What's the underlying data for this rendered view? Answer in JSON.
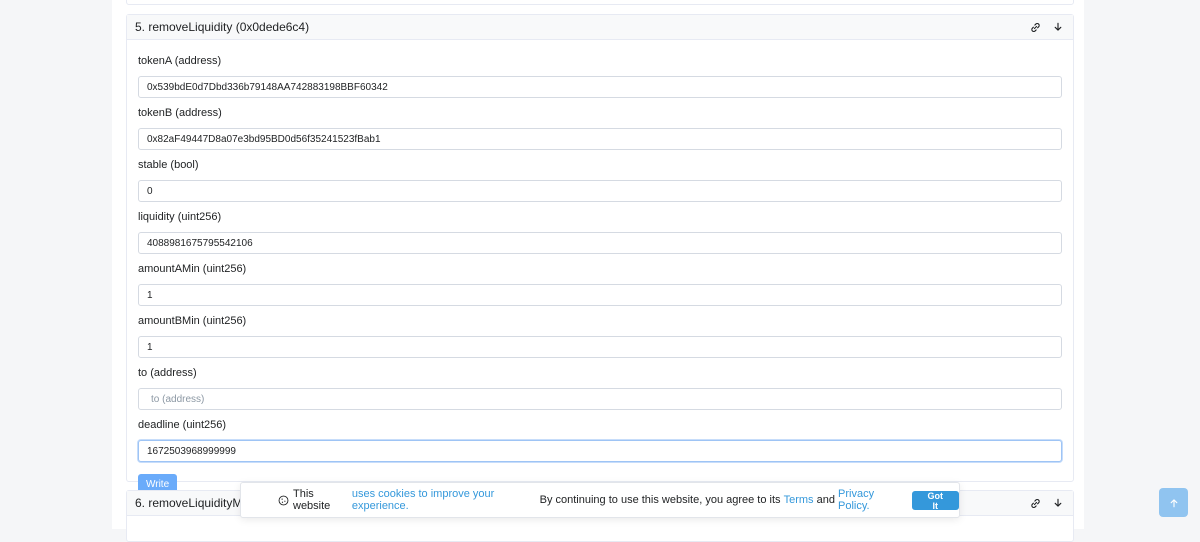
{
  "colors": {
    "accent": "#3498db",
    "write_button": "#6aabfa",
    "scroll_top_button": "#90c4f0",
    "border": "#e7eaf3"
  },
  "function_5": {
    "title": "5. removeLiquidity (0x0dede6c4)",
    "icons": [
      "link-icon",
      "arrow-down-icon"
    ],
    "fields": [
      {
        "label": "tokenA (address)",
        "value": "0x539bdE0d7Dbd336b79148AA742883198BBF60342",
        "placeholder": "tokenA (address)"
      },
      {
        "label": "tokenB (address)",
        "value": "0x82aF49447D8a07e3bd95BD0d56f35241523fBab1",
        "placeholder": "tokenB (address)"
      },
      {
        "label": "stable (bool)",
        "value": "0",
        "placeholder": "stable (bool)"
      },
      {
        "label": "liquidity (uint256)",
        "value": "4088981675795542106",
        "placeholder": "liquidity (uint256)"
      },
      {
        "label": "amountAMin (uint256)",
        "value": "1",
        "placeholder": "amountAMin (uint256)"
      },
      {
        "label": "amountBMin (uint256)",
        "value": "1",
        "placeholder": "amountBMin (uint256)"
      },
      {
        "label": "to (address)",
        "value": "",
        "placeholder": "to (address)"
      },
      {
        "label": "deadline (uint256)",
        "value": "1672503968999999",
        "placeholder": "deadline (uint256)"
      }
    ],
    "write_label": "Write"
  },
  "function_6": {
    "title": "6. removeLiquidityMATIC (",
    "icons": [
      "link-icon",
      "arrow-down-icon"
    ]
  },
  "cookie_banner": {
    "text_before": "This website ",
    "link_1": "uses cookies to improve your experience.",
    "text_middle": " By continuing to use this website, you agree to its ",
    "link_terms": "Terms",
    "text_and": " and ",
    "link_privacy": "Privacy Policy.",
    "button_label": "Got It"
  },
  "scroll_top": {
    "icon": "arrow-up-icon"
  }
}
